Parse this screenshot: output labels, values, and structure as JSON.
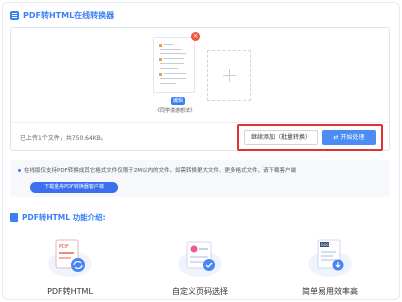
{
  "header": {
    "title": "PDF转HTML在线转换器"
  },
  "file": {
    "name": "《同学漫游想法》",
    "edit_badge": "编辑",
    "delete_icon": "×"
  },
  "status": {
    "count_text": "已上传1个文件，共750.64KB。"
  },
  "actions": {
    "continue_label": "继续添加（批量转换）",
    "start_label": "开始处理",
    "start_icon": "⇄"
  },
  "notice": {
    "text": "在线版仅支持PDF转换成其它格式文件仅限于2M以内的文件。如需转换更大文件、更多格式文件，请下载客户端",
    "download_label": "下载金舟PDF转换器客户端"
  },
  "features": {
    "title": "PDF转HTML 功能介绍:",
    "items": [
      {
        "label": "PDF转HTML"
      },
      {
        "label": "自定义页码选择"
      },
      {
        "label": "简单易用效率高"
      }
    ]
  },
  "colors": {
    "accent": "#3b7ff5",
    "highlight": "#e03232",
    "delete": "#f0533c"
  }
}
